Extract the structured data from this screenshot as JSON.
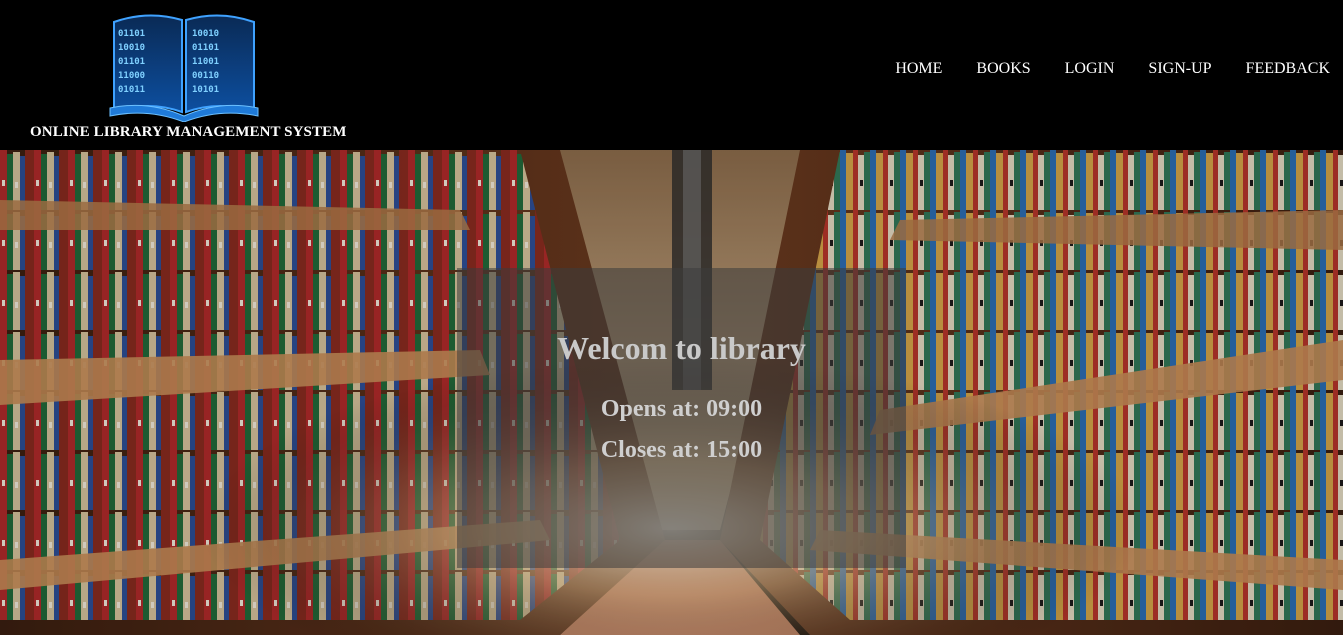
{
  "header": {
    "logo_icon": "open-book-binary-icon",
    "site_title": "ONLINE LIBRARY MANAGEMENT SYSTEM",
    "nav": [
      {
        "label": "HOME"
      },
      {
        "label": "BOOKS"
      },
      {
        "label": "LOGIN"
      },
      {
        "label": "SIGN-UP"
      },
      {
        "label": "FEEDBACK"
      }
    ]
  },
  "hero": {
    "background": "library-aisle-photo",
    "welcome": "Welcom to library",
    "opens": "Opens at: 09:00",
    "closes": "Closes at: 15:00"
  },
  "colors": {
    "header_bg": "#000000",
    "nav_text": "#ffffff",
    "logo_blue": "#2a8fe6",
    "overlay_text": "#c9c9c9"
  }
}
